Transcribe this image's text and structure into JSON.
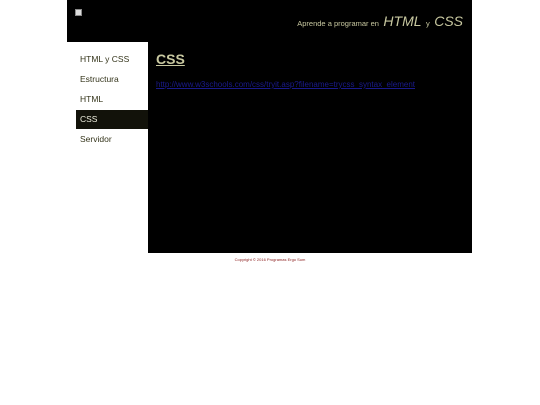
{
  "header": {
    "tagline_prefix": "Aprende a programar en",
    "tagline_html": "HTML",
    "tagline_and": "y",
    "tagline_css": "CSS",
    "logo_icon": "broken-image-icon"
  },
  "sidebar": {
    "items": [
      {
        "label": "HTML y CSS"
      },
      {
        "label": "Estructura"
      },
      {
        "label": "HTML"
      },
      {
        "label": "CSS",
        "active": true
      },
      {
        "label": "Servidor"
      }
    ]
  },
  "main": {
    "title": "CSS",
    "link_text": "http://www.w3schools.com/css/tryit.asp?filename=trycss_syntax_element"
  },
  "footer": {
    "text": "Copyright © 2016 Programas Ergo Sum"
  },
  "colors": {
    "background": "#000000",
    "accent": "#c8c8a0",
    "sidebar_active": "#12120a",
    "link": "#1a1a8c",
    "footer_text": "#8a1a1a"
  }
}
